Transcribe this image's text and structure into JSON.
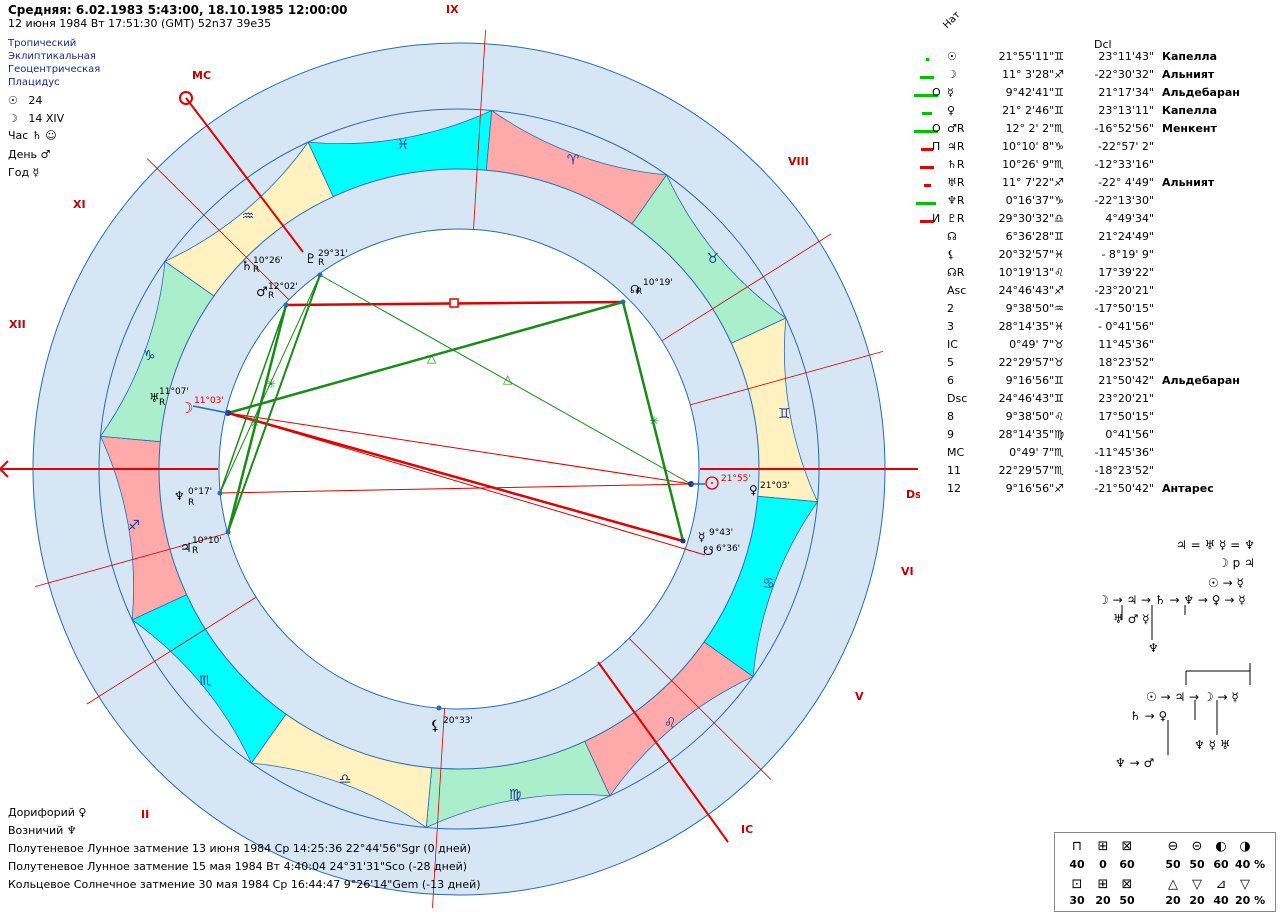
{
  "header": {
    "title": "Средняя: 6.02.1983  5:43:00, 18.10.1985 12:00:00",
    "subtitle": "12 июня 1984  Вт  17:51:30 (GMT) 52n37  39e35"
  },
  "system": [
    "Тропический",
    "Эклиптикальная",
    "Геоцентрическая",
    "Плацидус"
  ],
  "rulers": [
    {
      "glyph": "☉",
      "text": "24"
    },
    {
      "glyph": "☽",
      "text": "14 XIV"
    },
    {
      "label": "Час",
      "glyph": "♄ ☺"
    },
    {
      "label": "День",
      "glyph": "♂"
    },
    {
      "label": "Год",
      "glyph": "☿"
    }
  ],
  "chart": {
    "angles": {
      "mc": "MC",
      "ic": "IC",
      "asc": "Asc",
      "dsc": "Dsc"
    },
    "house_numbers": [
      "IX",
      "VIII",
      "XI",
      "XII",
      "VI",
      "V",
      "II",
      "IC"
    ],
    "signs": [
      "♎",
      "♍",
      "♌",
      "♋",
      "♊",
      "♉",
      "♈",
      "♓",
      "♒",
      "♑",
      "♐",
      "♏"
    ],
    "planet_labels": [
      {
        "glyph": "♄",
        "deg": "10°26'",
        "retro": "R"
      },
      {
        "glyph": "♇",
        "deg": "29°31'",
        "retro": "R"
      },
      {
        "glyph": "♂",
        "deg": "12°02'",
        "retro": "R"
      },
      {
        "glyph": "☊",
        "deg": "10°19'",
        "retro": "R"
      },
      {
        "glyph": "♅",
        "deg": "11°07'",
        "retro": "R"
      },
      {
        "glyph": "☽",
        "deg": "11°03'"
      },
      {
        "glyph": "♆",
        "deg": "0°17'",
        "retro": "R"
      },
      {
        "glyph": "♃",
        "deg": "10°10'",
        "retro": "R"
      },
      {
        "glyph": "☉",
        "deg": "21°55'"
      },
      {
        "glyph": "♀",
        "deg": "21°03'"
      },
      {
        "glyph": "☿",
        "deg": "9°43'"
      },
      {
        "glyph": "☋",
        "deg": "6°36'"
      },
      {
        "glyph": "⚸",
        "deg": "20°33'"
      }
    ]
  },
  "table": {
    "col_nat": "Нат",
    "col_dcl": "Dcl",
    "rows": [
      {
        "flag": "",
        "glyph": "☉",
        "lon": "21°55'11\"♊",
        "dcl": "23°11'43\"",
        "star": "Капелла",
        "bar": 3,
        "barColor": "#00c000"
      },
      {
        "flag": "",
        "glyph": "☽",
        "lon": "11° 3'28\"♐",
        "dcl": "-22°30'32\"",
        "star": "Альният",
        "bar": 14,
        "barColor": "#00c000"
      },
      {
        "flag": "О",
        "glyph": "☿",
        "lon": "9°42'41\"♊",
        "dcl": "21°17'34\"",
        "star": "Альдебаран",
        "bar": 24,
        "barColor": "#00c000"
      },
      {
        "flag": "",
        "glyph": "♀",
        "lon": "21° 2'46\"♊",
        "dcl": "23°13'11\"",
        "star": "Капелла",
        "bar": 10,
        "barColor": "#00c000"
      },
      {
        "flag": "О",
        "glyph": "♂R",
        "lon": "12° 2' 2\"♏",
        "dcl": "-16°52'56\"",
        "star": "Менкент",
        "bar": 24,
        "barColor": "#00c000"
      },
      {
        "flag": "П",
        "glyph": "♃R",
        "lon": "10°10' 8\"♑",
        "dcl": "-22°57' 2\"",
        "star": "",
        "bar": 12,
        "barColor": "#e00000"
      },
      {
        "flag": "",
        "glyph": "♄R",
        "lon": "10°26' 9\"♏",
        "dcl": "-12°33'16\"",
        "star": "",
        "bar": 14,
        "barColor": "#e00000"
      },
      {
        "flag": "",
        "glyph": "♅R",
        "lon": "11° 7'22\"♐",
        "dcl": "-22° 4'49\"",
        "star": "Альният",
        "bar": 7,
        "barColor": "#e00000"
      },
      {
        "flag": "",
        "glyph": "♆R",
        "lon": "0°16'37\"♑",
        "dcl": "-22°13'30\"",
        "star": "",
        "bar": 20,
        "barColor": "#00c000"
      },
      {
        "flag": "И",
        "glyph": "♇R",
        "lon": "29°30'32\"♎",
        "dcl": "4°49'34\"",
        "star": "",
        "bar": 14,
        "barColor": "#e00000"
      },
      {
        "flag": "",
        "glyph": "☊",
        "lon": "6°36'28\"♊",
        "dcl": "21°24'49\"",
        "star": "",
        "bar": 0,
        "barColor": "#00c000"
      },
      {
        "flag": "",
        "glyph": "⚸",
        "lon": "20°32'57\"♓",
        "dcl": "- 8°19' 9\"",
        "star": "",
        "bar": 0,
        "barColor": "#00c000"
      },
      {
        "flag": "",
        "glyph": "☊R",
        "lon": "10°19'13\"♌",
        "dcl": "17°39'22\"",
        "star": "",
        "bar": 0,
        "barColor": "#00c000"
      },
      {
        "flag": "",
        "glyph": "Asc",
        "lon": "24°46'43\"♐",
        "dcl": "-23°20'21\"",
        "star": "",
        "bar": 0,
        "barColor": "#00c000"
      },
      {
        "flag": "",
        "glyph": "2",
        "lon": "9°38'50\"♒",
        "dcl": "-17°50'15\"",
        "star": "",
        "bar": 0,
        "barColor": "#00c000"
      },
      {
        "flag": "",
        "glyph": "3",
        "lon": "28°14'35\"♓",
        "dcl": "- 0°41'56\"",
        "star": "",
        "bar": 0,
        "barColor": "#00c000"
      },
      {
        "flag": "",
        "glyph": "IC",
        "lon": "0°49' 7\"♉",
        "dcl": "11°45'36\"",
        "star": "",
        "bar": 0,
        "barColor": "#00c000"
      },
      {
        "flag": "",
        "glyph": "5",
        "lon": "22°29'57\"♉",
        "dcl": "18°23'52\"",
        "star": "",
        "bar": 0,
        "barColor": "#00c000"
      },
      {
        "flag": "",
        "glyph": "6",
        "lon": "9°16'56\"♊",
        "dcl": "21°50'42\"",
        "star": "Альдебаран",
        "bar": 0,
        "barColor": "#00c000"
      },
      {
        "flag": "",
        "glyph": "Dsc",
        "lon": "24°46'43\"♊",
        "dcl": "23°20'21\"",
        "star": "",
        "bar": 0,
        "barColor": "#00c000"
      },
      {
        "flag": "",
        "glyph": "8",
        "lon": "9°38'50\"♌",
        "dcl": "17°50'15\"",
        "star": "",
        "bar": 0,
        "barColor": "#00c000"
      },
      {
        "flag": "",
        "glyph": "9",
        "lon": "28°14'35\"♍",
        "dcl": "0°41'56\"",
        "star": "",
        "bar": 0,
        "barColor": "#00c000"
      },
      {
        "flag": "",
        "glyph": "MC",
        "lon": "0°49' 7\"♏",
        "dcl": "-11°45'36\"",
        "star": "",
        "bar": 0,
        "barColor": "#00c000"
      },
      {
        "flag": "",
        "glyph": "11",
        "lon": "22°29'57\"♏",
        "dcl": "-18°23'52\"",
        "star": "",
        "bar": 0,
        "barColor": "#00c000"
      },
      {
        "flag": "",
        "glyph": "12",
        "lon": "9°16'56\"♐",
        "dcl": "-21°50'42\"",
        "star": "Антарес",
        "bar": 0,
        "barColor": "#00c000"
      }
    ]
  },
  "formulas": {
    "f1": "♃ = ♅  ☿ = ♆",
    "f2": "☽ p ♃",
    "f3": "☉ → ☿",
    "f4": "☽ → ♃ → ♄ → ♆ → ♀ → ☿",
    "f5": "♅      ♂ ☿",
    "f6": "♆",
    "f7": "☉ → ♃ → ☽ → ☿",
    "f8": "♄ → ♀",
    "f9": "♆ ☿ ♅",
    "f10": "♆ → ♂"
  },
  "bottom": {
    "doryphory": "Дорифорий  ♀",
    "charioteer": "Возничий  ♆",
    "eclipses": [
      "Полутеневое Лунное затмение 13 июня 1984 Ср 14:25:36 22°44'56\"Sgr (0 дней)",
      "Полутеневое Лунное затмение 15 мая 1984 Вт  4:40:04 24°31'31\"Sco (-28 дней)",
      "Кольцевое Солнечное затмение 30 мая 1984 Ср 16:44:47  9°26'14\"Gem (-13 дней)"
    ]
  },
  "quality_box": {
    "icons_left": [
      "⊓",
      "⊞",
      "⊠"
    ],
    "values_left": [
      "40",
      "0",
      "60"
    ],
    "icons_left2": [
      "⊡",
      "⊞",
      "⊠"
    ],
    "values_left2": [
      "30",
      "20",
      "50"
    ],
    "icons_right": [
      "⊖",
      "⊝",
      "◐",
      "◑"
    ],
    "values_right": [
      "50",
      "50",
      "60",
      "40 %"
    ],
    "icons_right2": [
      "△",
      "▽",
      "⊿",
      "▽"
    ],
    "values_right2": [
      "20",
      "20",
      "40",
      "20 %"
    ]
  },
  "colors": {
    "fire": "#ffaaaa",
    "earth": "#aaeecc",
    "air": "#fff2c0",
    "water": "#00ffff",
    "ring": "#d6e6f5",
    "house_line": "#dd0000"
  }
}
